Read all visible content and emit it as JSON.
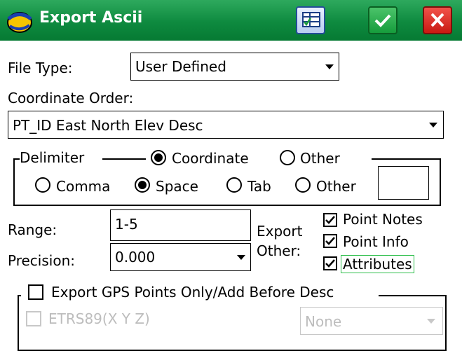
{
  "window": {
    "title": "Export Ascii"
  },
  "toolbar": {
    "grid_icon": "table-view-icon",
    "ok_icon": "checkmark-icon",
    "close_icon": "close-x-icon"
  },
  "colors": {
    "title_bar": "#0e8a3f",
    "ok": "#169c3c",
    "close": "#c81a12",
    "focus": "#2fbf4c"
  },
  "file_type": {
    "label": "File Type:",
    "value": "User Defined"
  },
  "coordinate_order": {
    "label": "Coordinate Order:",
    "value": "PT_ID East North Elev Desc"
  },
  "delimiter": {
    "label": "Delimiter",
    "scope": [
      {
        "label": "Coordinate",
        "selected": true
      },
      {
        "label": "Other",
        "selected": false
      }
    ],
    "options": [
      {
        "label": "Comma",
        "selected": false
      },
      {
        "label": "Space",
        "selected": true
      },
      {
        "label": "Tab",
        "selected": false
      },
      {
        "label": "Other",
        "selected": false
      }
    ],
    "other_value": ""
  },
  "range": {
    "label": "Range:",
    "value": "1-5"
  },
  "precision": {
    "label": "Precision:",
    "value": "0.000"
  },
  "export_other": {
    "label_line1": "Export",
    "label_line2": "Other:",
    "items": [
      {
        "label": "Point Notes",
        "checked": true
      },
      {
        "label": "Point Info",
        "checked": true
      },
      {
        "label": "Attributes",
        "checked": true
      }
    ]
  },
  "gps": {
    "label": "Export GPS Points Only/Add Before Desc",
    "checked": false
  },
  "etrs": {
    "label": "ETRS89(X Y Z)",
    "checked": false,
    "dropdown_value": "None"
  }
}
